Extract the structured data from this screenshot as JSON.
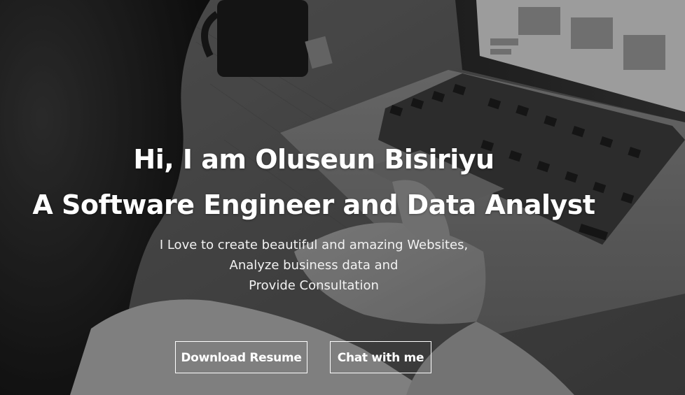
{
  "hero": {
    "greeting": "Hi, I am Oluseun Bisiriyu",
    "title": "A Software Engineer and Data Analyst",
    "tagline": [
      "I Love to create beautiful and amazing Websites,",
      "Analyze business data and",
      "Provide Consultation"
    ],
    "buttons": {
      "download_resume": "Download Resume",
      "chat": "Chat with me"
    }
  },
  "colors": {
    "text": "#ffffff",
    "button_border": "#ffffff"
  }
}
